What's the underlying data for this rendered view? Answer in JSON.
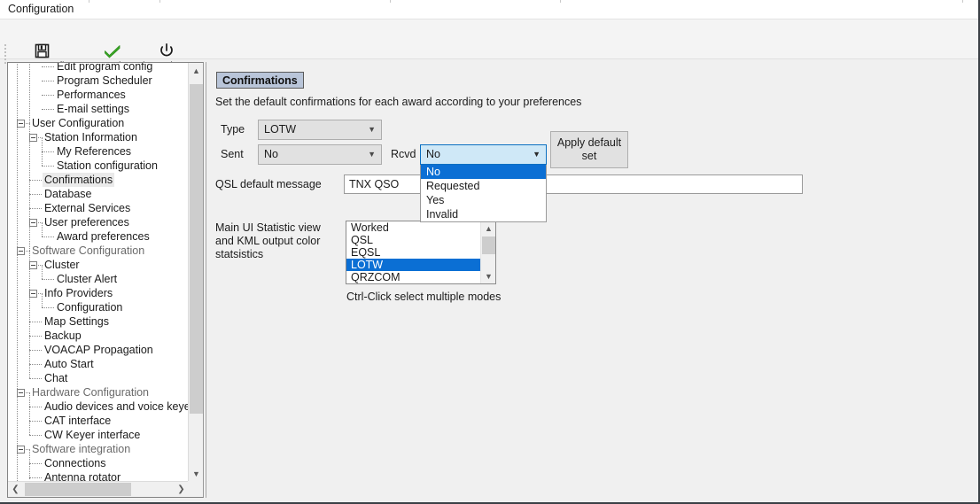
{
  "window": {
    "title": "Configuration"
  },
  "toolbar": {
    "buttons": [
      {
        "label": "Save config",
        "icon": "floppy-disk-icon"
      },
      {
        "label": "Save and apply",
        "icon": "green-check-icon"
      },
      {
        "label": "Exit",
        "icon": "power-icon"
      }
    ]
  },
  "tree": {
    "items": [
      {
        "label": "Edit program config",
        "depth": 2,
        "group": false,
        "expander": false,
        "selected": false
      },
      {
        "label": "Program Scheduler",
        "depth": 2,
        "group": false,
        "expander": false,
        "selected": false
      },
      {
        "label": "Performances",
        "depth": 2,
        "group": false,
        "expander": false,
        "selected": false
      },
      {
        "label": "E-mail settings",
        "depth": 2,
        "group": false,
        "expander": false,
        "selected": false
      },
      {
        "label": "User Configuration",
        "depth": 0,
        "group": false,
        "expander": true,
        "selected": false
      },
      {
        "label": "Station Information",
        "depth": 1,
        "group": false,
        "expander": true,
        "selected": false
      },
      {
        "label": "My References",
        "depth": 2,
        "group": false,
        "expander": false,
        "selected": false
      },
      {
        "label": "Station configuration",
        "depth": 2,
        "group": false,
        "expander": false,
        "selected": false
      },
      {
        "label": "Confirmations",
        "depth": 1,
        "group": false,
        "expander": false,
        "selected": true
      },
      {
        "label": "Database",
        "depth": 1,
        "group": false,
        "expander": false,
        "selected": false
      },
      {
        "label": "External Services",
        "depth": 1,
        "group": false,
        "expander": false,
        "selected": false
      },
      {
        "label": "User preferences",
        "depth": 1,
        "group": false,
        "expander": true,
        "selected": false
      },
      {
        "label": "Award preferences",
        "depth": 2,
        "group": false,
        "expander": false,
        "selected": false
      },
      {
        "label": "Software Configuration",
        "depth": 0,
        "group": true,
        "expander": true,
        "selected": false
      },
      {
        "label": "Cluster",
        "depth": 1,
        "group": false,
        "expander": true,
        "selected": false
      },
      {
        "label": "Cluster Alert",
        "depth": 2,
        "group": false,
        "expander": false,
        "selected": false
      },
      {
        "label": "Info Providers",
        "depth": 1,
        "group": false,
        "expander": true,
        "selected": false
      },
      {
        "label": "Configuration",
        "depth": 2,
        "group": false,
        "expander": false,
        "selected": false
      },
      {
        "label": "Map Settings",
        "depth": 1,
        "group": false,
        "expander": false,
        "selected": false
      },
      {
        "label": "Backup",
        "depth": 1,
        "group": false,
        "expander": false,
        "selected": false
      },
      {
        "label": "VOACAP Propagation",
        "depth": 1,
        "group": false,
        "expander": false,
        "selected": false
      },
      {
        "label": "Auto Start",
        "depth": 1,
        "group": false,
        "expander": false,
        "selected": false
      },
      {
        "label": "Chat",
        "depth": 1,
        "group": false,
        "expander": false,
        "selected": false
      },
      {
        "label": "Hardware Configuration",
        "depth": 0,
        "group": true,
        "expander": true,
        "selected": false
      },
      {
        "label": "Audio devices and voice keyer",
        "depth": 1,
        "group": false,
        "expander": false,
        "selected": false
      },
      {
        "label": "CAT interface",
        "depth": 1,
        "group": false,
        "expander": false,
        "selected": false
      },
      {
        "label": "CW Keyer interface",
        "depth": 1,
        "group": false,
        "expander": false,
        "selected": false
      },
      {
        "label": "Software integration",
        "depth": 0,
        "group": true,
        "expander": true,
        "selected": false
      },
      {
        "label": "Connections",
        "depth": 1,
        "group": false,
        "expander": false,
        "selected": false
      },
      {
        "label": "Antenna rotator",
        "depth": 1,
        "group": false,
        "expander": false,
        "selected": false
      }
    ]
  },
  "panel": {
    "badge": "Confirmations",
    "subtitle": "Set the default confirmations for each award according to your preferences",
    "type_label": "Type",
    "type_value": "LOTW",
    "sent_label": "Sent",
    "sent_value": "No",
    "rcvd_label": "Rcvd",
    "rcvd_value": "No",
    "rcvd_options": [
      {
        "label": "No",
        "highlighted": true
      },
      {
        "label": "Requested",
        "highlighted": false
      },
      {
        "label": "Yes",
        "highlighted": false
      },
      {
        "label": "Invalid",
        "highlighted": false
      }
    ],
    "save_icon": "floppy-disk-icon",
    "delete_icon": "red-x-icon",
    "apply_button": "Apply default\nset",
    "qsl_label": "QSL default message",
    "qsl_value": "TNX QSO",
    "stat_label": "Main UI Statistic view\nand KML output color\nstatsistics",
    "stat_items": [
      {
        "label": "Worked",
        "selected": false
      },
      {
        "label": "QSL",
        "selected": false
      },
      {
        "label": "EQSL",
        "selected": false
      },
      {
        "label": "LOTW",
        "selected": true
      },
      {
        "label": "QRZCOM",
        "selected": false
      }
    ],
    "stat_hint": "Ctrl-Click select multiple modes"
  },
  "colors": {
    "accent": "#0b6fd4",
    "badge_bg": "#b9c5d9",
    "window_bg": "#f0f0f0"
  }
}
